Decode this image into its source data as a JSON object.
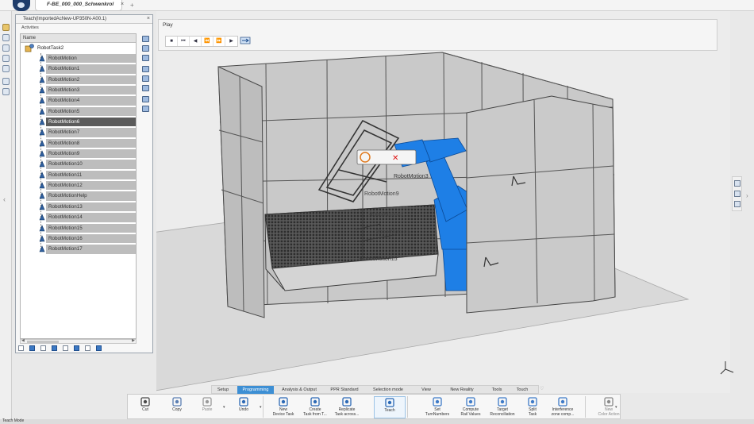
{
  "app": {
    "document_tab": "F-BE_000_000_Schwenkrol",
    "close_icon": "close-icon",
    "add_tab_icon": "plus-icon"
  },
  "panel": {
    "title": "Teach(ImportedAcNew-UP350N-A00.1)",
    "activities_label": "Activities",
    "column_header": "Name",
    "root": "RobotTask2",
    "items": [
      "RobotMotion",
      "RobotMotion1",
      "RobotMotion2",
      "RobotMotion3",
      "RobotMotion4",
      "RobotMotion5",
      "RobotMotion6",
      "RobotMotion7",
      "RobotMotion8",
      "RobotMotion9",
      "RobotMotion10",
      "RobotMotion11",
      "RobotMotion12",
      "RobotMotionHelp",
      "RobotMotion13",
      "RobotMotion14",
      "RobotMotion15",
      "RobotMotion16",
      "RobotMotion17"
    ],
    "selected_item": "RobotMotion6"
  },
  "play": {
    "label": "Play"
  },
  "viewport": {
    "labels": [
      "RobotMotion3",
      "RobotMotion9",
      "RobotMotion2",
      "RobotMotion1",
      "RobotMotion15"
    ]
  },
  "tabs": [
    {
      "label": "Setup",
      "active": false
    },
    {
      "label": "Programming",
      "active": true
    },
    {
      "label": "Analysis & Output",
      "active": false
    },
    {
      "label": "PPR Standard",
      "active": false
    },
    {
      "label": "Selection mode",
      "active": false
    },
    {
      "label": "View",
      "active": false
    },
    {
      "label": "New Reality",
      "active": false
    },
    {
      "label": "Tools",
      "active": false
    },
    {
      "label": "Touch",
      "active": false
    }
  ],
  "actions": [
    {
      "label": "Cut",
      "icon": "scissors-icon"
    },
    {
      "label": "Copy",
      "icon": "copy-icon"
    },
    {
      "label": "Paste",
      "icon": "paste-icon"
    },
    {
      "label": "Undo",
      "icon": "undo-icon"
    },
    {
      "label": "New\nDevice Task",
      "icon": "device-task-icon"
    },
    {
      "label": "Create\nTask from T...",
      "icon": "task-from-template-icon"
    },
    {
      "label": "Replicate\nTask across...",
      "icon": "replicate-task-icon"
    },
    {
      "label": "Teach",
      "icon": "teach-icon"
    },
    {
      "label": "Set\nTurnNumbers",
      "icon": "turn-numbers-icon"
    },
    {
      "label": "Compute\nRail Values",
      "icon": "rail-values-icon"
    },
    {
      "label": "Target\nReconciliation",
      "icon": "target-reconciliation-icon"
    },
    {
      "label": "Split\nTask",
      "icon": "split-task-icon"
    },
    {
      "label": "Interference\nzone comp...",
      "icon": "interference-zone-icon"
    },
    {
      "label": "New\nColor Action",
      "icon": "color-action-icon"
    }
  ],
  "status": {
    "text": "Teach Mode"
  },
  "colors": {
    "accent": "#3d8fd4",
    "robot": "#1e7fe6",
    "selected_row": "#5b5b5b",
    "row": "#bdbdbd"
  }
}
